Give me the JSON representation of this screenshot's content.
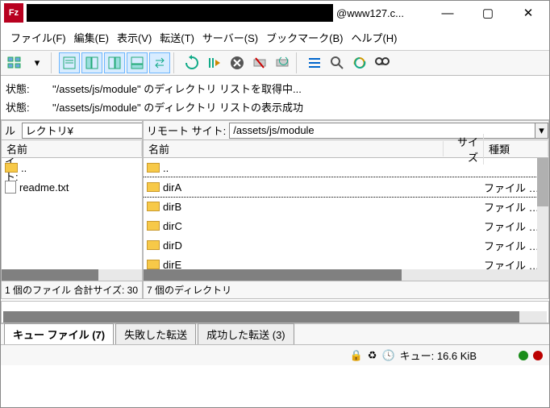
{
  "title": {
    "suffix": "@www127.c..."
  },
  "window_buttons": {
    "min": "—",
    "max": "▢",
    "close": "✕"
  },
  "menu": [
    "ファイル(F)",
    "編集(E)",
    "表示(V)",
    "転送(T)",
    "サーバー(S)",
    "ブックマーク(B)",
    "ヘルプ(H)"
  ],
  "status_log": [
    {
      "label": "状態:",
      "text": "\"/assets/js/module\" のディレクトリ リストを取得中..."
    },
    {
      "label": "状態:",
      "text": "\"/assets/js/module\" のディレクトリ リストの表示成功"
    }
  ],
  "local": {
    "path_label": "ローカル サイト:",
    "path_value": "レクトリ¥",
    "columns": {
      "name": "名前"
    },
    "items": [
      {
        "name": "..",
        "kind": "folder"
      },
      {
        "name": "readme.txt",
        "kind": "file"
      }
    ],
    "status": "1 個のファイル 合計サイズ: 30"
  },
  "remote": {
    "path_label": "リモート サイト:",
    "path_value": "/assets/js/module",
    "columns": {
      "name": "名前",
      "size": "サイズ",
      "type": "種類"
    },
    "items": [
      {
        "name": "..",
        "kind": "folder",
        "type": ""
      },
      {
        "name": "dirA",
        "kind": "folder",
        "type": "ファイル フ...",
        "selected": true
      },
      {
        "name": "dirB",
        "kind": "folder",
        "type": "ファイル フ..."
      },
      {
        "name": "dirC",
        "kind": "folder",
        "type": "ファイル フ..."
      },
      {
        "name": "dirD",
        "kind": "folder",
        "type": "ファイル フ..."
      },
      {
        "name": "dirE",
        "kind": "folder",
        "type": "ファイル フ..."
      }
    ],
    "status": "7 個のディレクトリ"
  },
  "tabs": [
    {
      "label": "キュー ファイル (7)",
      "active": true
    },
    {
      "label": "失敗した転送"
    },
    {
      "label": "成功した転送 (3)"
    }
  ],
  "statusbar": {
    "queue": "キュー: 16.6 KiB"
  }
}
